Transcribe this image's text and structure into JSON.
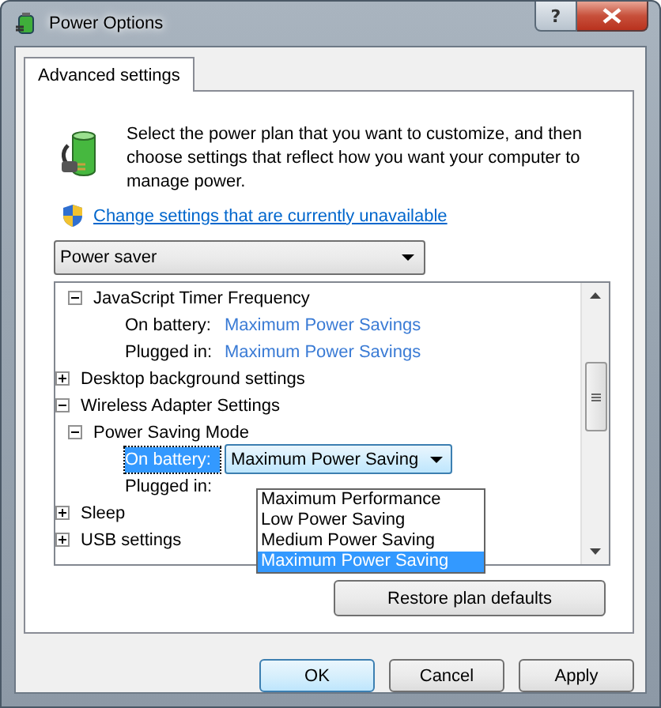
{
  "window": {
    "title": "Power Options",
    "help_label": "?"
  },
  "tabs": [
    {
      "label": "Advanced settings",
      "selected": true
    }
  ],
  "intro": "Select the power plan that you want to customize, and then choose settings that reflect how you want your computer to manage power.",
  "link": "Change settings that are currently unavailable",
  "plan_select": {
    "value": "Power saver"
  },
  "tree": {
    "items": [
      {
        "children": [
          {
            "label": "JavaScript Timer Frequency",
            "expanded": true,
            "selected": false,
            "children": [
              {
                "label": "On battery:",
                "kind": "link",
                "value": "Maximum Power Savings",
                "selected": false
              },
              {
                "label": "Plugged in:",
                "kind": "link",
                "value": "Maximum Power Savings",
                "selected": false
              }
            ]
          }
        ]
      },
      {
        "label": "Desktop background settings",
        "expanded": false,
        "selected": false
      },
      {
        "label": "Wireless Adapter Settings",
        "expanded": true,
        "selected": false,
        "children": [
          {
            "label": "Power Saving Mode",
            "expanded": true,
            "selected": false,
            "children": [
              {
                "label": "On battery:",
                "kind": "combo",
                "value": "Maximum Power Saving",
                "selected": true,
                "open": true,
                "options": [
                  {
                    "label": "Maximum Performance",
                    "selected": false
                  },
                  {
                    "label": "Low Power Saving",
                    "selected": false
                  },
                  {
                    "label": "Medium Power Saving",
                    "selected": false
                  },
                  {
                    "label": "Maximum Power Saving",
                    "selected": true
                  }
                ]
              },
              {
                "label": "Plugged in:",
                "selected": false
              }
            ]
          }
        ]
      },
      {
        "label": "Sleep",
        "expanded": false,
        "selected": false
      },
      {
        "label": "USB settings",
        "expanded": false,
        "selected": false
      }
    ]
  },
  "restore_button": "Restore plan defaults",
  "buttons": [
    {
      "label": "OK",
      "default": true
    },
    {
      "label": "Cancel",
      "default": false
    },
    {
      "label": "Apply",
      "default": false
    }
  ]
}
